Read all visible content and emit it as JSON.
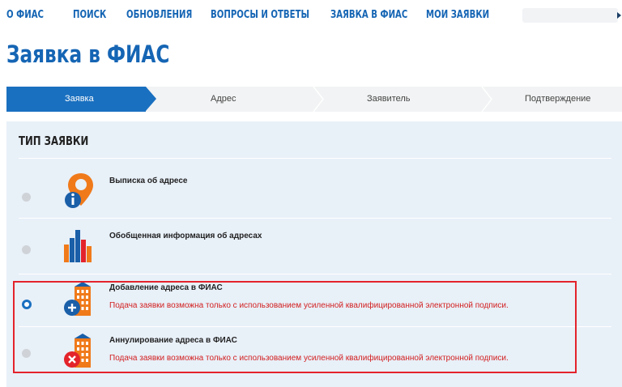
{
  "nav": {
    "items": [
      "О ФИАС",
      "ПОИСК",
      "ОБНОВЛЕНИЯ",
      "ВОПРОСЫ И ОТВЕТЫ",
      "ЗАЯВКА В ФИАС",
      "МОИ ЗАЯВКИ"
    ]
  },
  "page_title": "Заявка в ФИАС",
  "steps": [
    "Заявка",
    "Адрес",
    "Заявитель",
    "Подтверждение"
  ],
  "section_title": "ТИП ЗАЯВКИ",
  "options": [
    {
      "label": "Выписка об адресе",
      "note": "",
      "selected": false,
      "icon": "location-pin-info-icon"
    },
    {
      "label": "Обобщенная информация об адресах",
      "note": "",
      "selected": false,
      "icon": "bar-chart-icon"
    },
    {
      "label": "Добавление адреса в ФИАС",
      "note": "Подача заявки возможна только с использованием усиленной квалифицированной электронной подписи.",
      "selected": true,
      "icon": "building-add-icon"
    },
    {
      "label": "Аннулирование адреса в ФИАС",
      "note": "Подача заявки возможна только с использованием усиленной квалифицированной электронной подписи.",
      "selected": false,
      "icon": "building-remove-icon"
    }
  ],
  "colors": {
    "accent": "#1565b4",
    "step_active": "#1a70c0",
    "panel_bg": "#e8f0f8",
    "warning": "#d21f1f",
    "highlight_border": "#e3232b"
  }
}
